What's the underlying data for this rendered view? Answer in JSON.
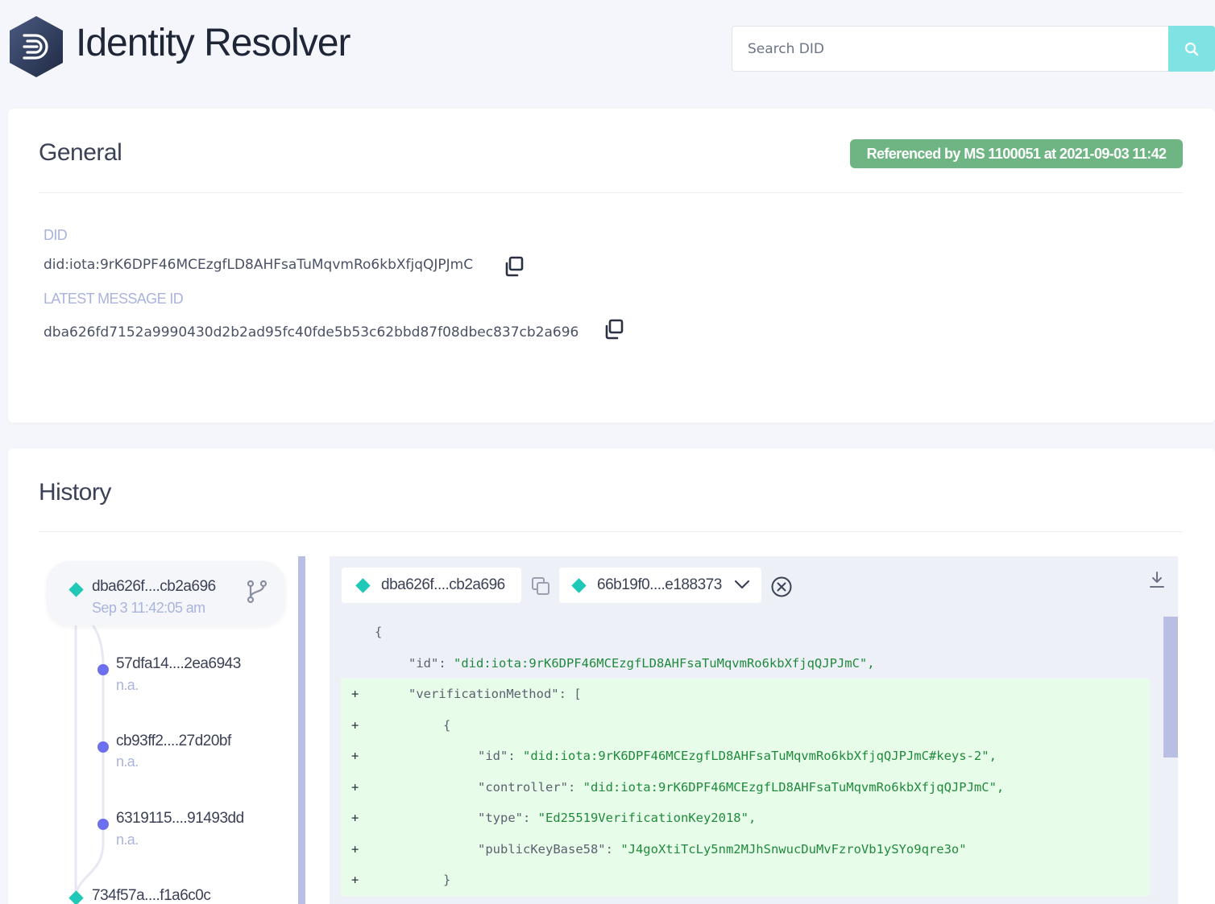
{
  "app": {
    "title": "Identity Resolver",
    "logo_icon": "iota-identity-logo"
  },
  "search": {
    "placeholder": "Search DID",
    "value": "",
    "button_icon": "search-icon",
    "button_color": "#7fe3e3"
  },
  "general": {
    "title": "General",
    "reference_badge": "Referenced by MS 1100051 at 2021-09-03 11:42",
    "badge_color": "#6fb583",
    "did_label": "DID",
    "did_value": "did:iota:9rK6DPF46MCEzgfLD8AHFsaTuMqvmRo6kbXfjqQJPJmC",
    "message_label": "LATEST MESSAGE ID",
    "message_value": "dba626fd7152a9990430d2b2ad95fc40fde5b53c62bbd87f08dbec837cb2a696"
  },
  "history": {
    "title": "History",
    "entries": [
      {
        "id": "dba626f....cb2a696",
        "sub": "Sep 3 11:42:05 am",
        "kind": "integration"
      },
      {
        "id": "57dfa14....2ea6943",
        "sub": "n.a.",
        "kind": "diff"
      },
      {
        "id": "cb93ff2....27d20bf",
        "sub": "n.a.",
        "kind": "diff"
      },
      {
        "id": "6319115....91493dd",
        "sub": "n.a.",
        "kind": "diff"
      },
      {
        "id": "734f57a....f1a6c0c",
        "sub": "",
        "kind": "integration"
      }
    ],
    "compare": {
      "left": "dba626f....cb2a696",
      "right": "66b19f0....e188373"
    },
    "diff_lines": [
      {
        "marker": "",
        "added": false,
        "indent": 0,
        "key": "{",
        "value": ""
      },
      {
        "marker": "",
        "added": false,
        "indent": 1,
        "key": "\"id\": ",
        "value": "\"did:iota:9rK6DPF46MCEzgfLD8AHFsaTuMqvmRo6kbXfjqQJPJmC\","
      },
      {
        "marker": "+",
        "added": true,
        "indent": 1,
        "key": "\"verificationMethod\": [",
        "value": ""
      },
      {
        "marker": "+",
        "added": true,
        "indent": 2,
        "key": "{",
        "value": ""
      },
      {
        "marker": "+",
        "added": true,
        "indent": 3,
        "key": "\"id\": ",
        "value": "\"did:iota:9rK6DPF46MCEzgfLD8AHFsaTuMqvmRo6kbXfjqQJPJmC#keys-2\","
      },
      {
        "marker": "+",
        "added": true,
        "indent": 3,
        "key": "\"controller\": ",
        "value": "\"did:iota:9rK6DPF46MCEzgfLD8AHFsaTuMqvmRo6kbXfjqQJPJmC\","
      },
      {
        "marker": "+",
        "added": true,
        "indent": 3,
        "key": "\"type\": ",
        "value": "\"Ed25519VerificationKey2018\","
      },
      {
        "marker": "+",
        "added": true,
        "indent": 3,
        "key": "\"publicKeyBase58\": ",
        "value": "\"J4goXtiTcLy5nm2MJhSnwucDuMvFzroVb1ySYo9qre3o\""
      },
      {
        "marker": "+",
        "added": true,
        "indent": 2,
        "key": "}",
        "value": ""
      }
    ]
  }
}
